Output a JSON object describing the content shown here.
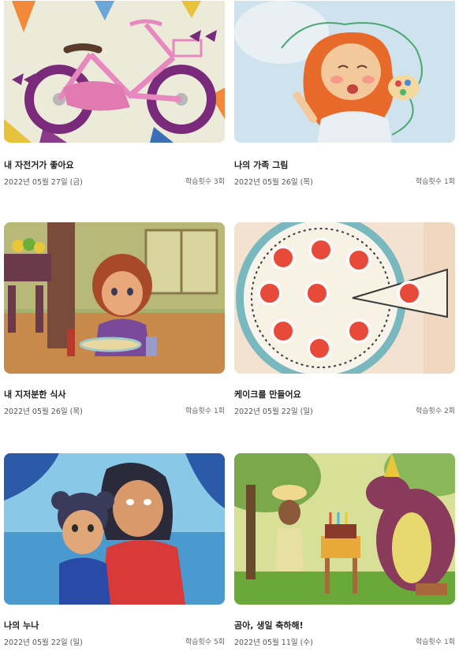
{
  "books": [
    {
      "title": "내 자전거가 좋아요",
      "date": "2022년 05월 27일 (금)",
      "count": "학습횟수 3회",
      "cover_icon": "bicycle-illustration"
    },
    {
      "title": "나의 가족 그림",
      "date": "2022년 05월 26일 (목)",
      "count": "학습횟수 1회",
      "cover_icon": "girl-painting-illustration"
    },
    {
      "title": "내 지저분한 식사",
      "date": "2022년 05월 26일 (목)",
      "count": "학습횟수 1회",
      "cover_icon": "girl-eating-illustration"
    },
    {
      "title": "케이크를 만들어요",
      "date": "2022년 05월 22일 (일)",
      "count": "학습횟수 2회",
      "cover_icon": "cake-illustration"
    },
    {
      "title": "나의 누나",
      "date": "2022년 05월 22일 (일)",
      "count": "학습횟수 5회",
      "cover_icon": "sisters-illustration"
    },
    {
      "title": "곰아, 생일 축하해!",
      "date": "2022년 05월 11일 (수)",
      "count": "학습횟수 1회",
      "cover_icon": "bear-birthday-illustration"
    }
  ]
}
